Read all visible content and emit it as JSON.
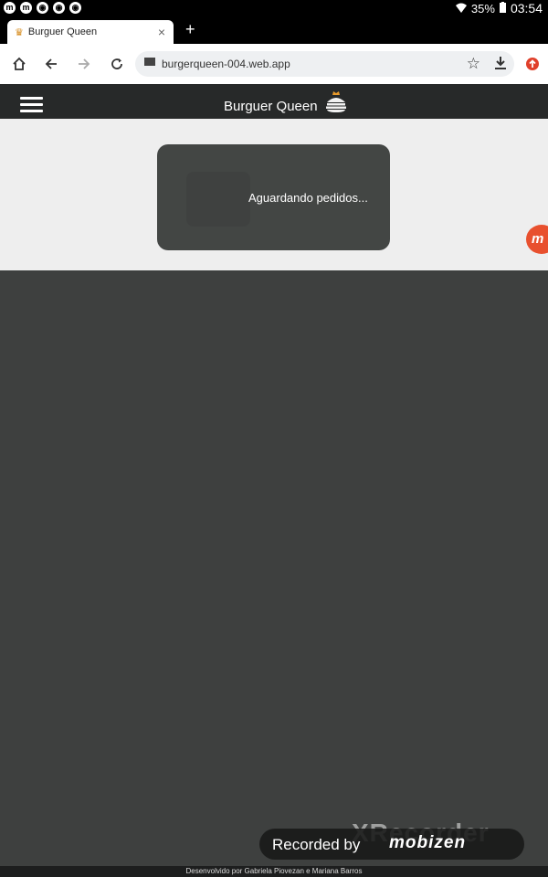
{
  "statusbar": {
    "notifications": [
      "m",
      "m",
      "◉",
      "◉",
      "◉"
    ],
    "battery": "35%",
    "time": "03:54"
  },
  "tab": {
    "title": "Burguer Queen",
    "close": "×"
  },
  "newtab": "+",
  "toolbar": {
    "url": "burgerqueen-004.web.app"
  },
  "app": {
    "title": "Burguer Queen"
  },
  "waiting": {
    "message": "Aguardando pedidos..."
  },
  "overlay": {
    "bubble_label": "m",
    "watermark": "XRecorder",
    "recorded_text": "Recorded by",
    "recorded_brand": "mobizen"
  },
  "footer": {
    "credit": "Desenvolvido por Gabriela Piovezan e Mariana Barros"
  },
  "colors": {
    "appbar": "#272929",
    "content_bg": "#eeeeee",
    "card_bg": "#434644",
    "page_bg": "#3e403f",
    "accent": "#e8502e"
  }
}
